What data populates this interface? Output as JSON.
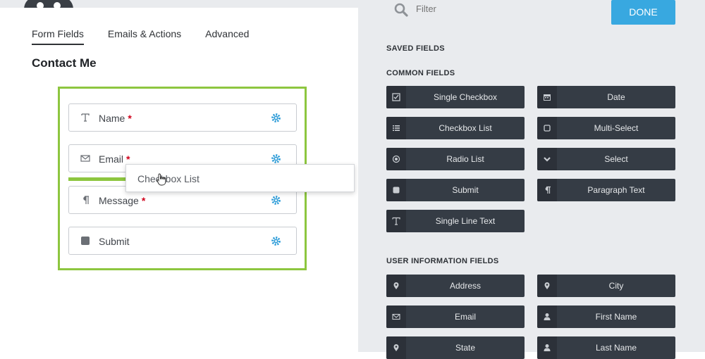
{
  "colors": {
    "accent_green": "#8dc63f",
    "done_blue": "#38a8e0",
    "button_dark": "#353c45",
    "gear_blue": "#2d9cd8",
    "required_red": "#d0021b"
  },
  "tabs": [
    {
      "label": "Form Fields",
      "active": true
    },
    {
      "label": "Emails & Actions",
      "active": false
    },
    {
      "label": "Advanced",
      "active": false
    }
  ],
  "form": {
    "title": "Contact Me",
    "fields": [
      {
        "label": "Name",
        "required": "*",
        "icon": "text-t-icon"
      },
      {
        "label": "Email",
        "required": "*",
        "icon": "envelope-icon"
      },
      {
        "label": "Message",
        "required": "*",
        "icon": "paragraph-icon"
      },
      {
        "label": "Submit",
        "required": "",
        "icon": "square-icon"
      }
    ],
    "dragging_label": "Checkbox List"
  },
  "panel": {
    "filter_placeholder": "Filter",
    "done_label": "DONE",
    "saved_fields_heading": "SAVED FIELDS",
    "common_fields_heading": "COMMON FIELDS",
    "common_fields": [
      {
        "label": "Single Checkbox",
        "icon": "checkbox-checked-icon"
      },
      {
        "label": "Date",
        "icon": "calendar-icon"
      },
      {
        "label": "Checkbox List",
        "icon": "list-icon"
      },
      {
        "label": "Multi-Select",
        "icon": "square-outline-icon"
      },
      {
        "label": "Radio List",
        "icon": "radio-icon"
      },
      {
        "label": "Select",
        "icon": "chevron-down-icon"
      },
      {
        "label": "Submit",
        "icon": "square-icon"
      },
      {
        "label": "Paragraph Text",
        "icon": "paragraph-icon"
      },
      {
        "label": "Single Line Text",
        "icon": "text-t-icon"
      }
    ],
    "user_info_heading": "USER INFORMATION FIELDS",
    "user_info_fields": [
      {
        "label": "Address",
        "icon": "map-marker-icon"
      },
      {
        "label": "City",
        "icon": "map-marker-icon"
      },
      {
        "label": "Email",
        "icon": "envelope-icon"
      },
      {
        "label": "First Name",
        "icon": "user-icon"
      },
      {
        "label": "State",
        "icon": "map-marker-icon"
      },
      {
        "label": "Last Name",
        "icon": "user-icon"
      }
    ]
  }
}
